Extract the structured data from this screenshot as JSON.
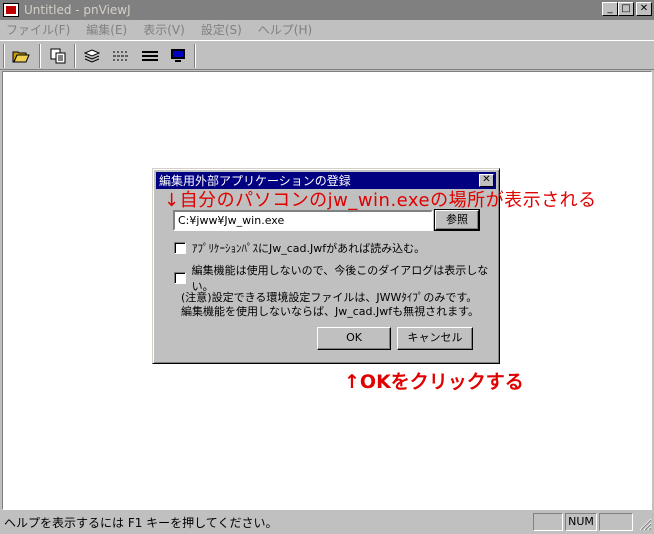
{
  "window": {
    "title": "Untitled - pnViewJ",
    "min_glyph": "_",
    "max_glyph": "□",
    "close_glyph": "✕"
  },
  "menu": [
    {
      "label": "ファイル(F)"
    },
    {
      "label": "編集(E)"
    },
    {
      "label": "表示(V)"
    },
    {
      "label": "設定(S)"
    },
    {
      "label": "ヘルプ(H)"
    }
  ],
  "toolbar": {
    "icons": [
      "folder-open-icon",
      "copy-icon",
      "layers-icon",
      "dashed-lines-icon",
      "solid-lines-icon",
      "monitor-icon"
    ]
  },
  "status": {
    "text": "ヘルプを表示するには F1 キーを押してください。",
    "num": "NUM"
  },
  "dialog": {
    "title": "編集用外部アプリケーションの登録",
    "close_glyph": "✕",
    "path_value": "C:¥jww¥Jw_win.exe",
    "browse_label": "参照",
    "check1_label": "ｱﾌﾟﾘｹｰｼｮﾝﾊﾟｽにJw_cad.Jwfがあれば読み込む。",
    "check1_checked": false,
    "check2_label": "編集機能は使用しないので、今後このダイアログは表示しない。",
    "check2_checked": false,
    "note_line1": "(注意)設定できる環境設定ファイルは、JWWﾀｲﾌﾟのみです。",
    "note_line2": "編集機能を使用しないならば、Jw_cad.Jwfも無視されます。",
    "ok_label": "OK",
    "cancel_label": "キャンセル"
  },
  "annotations": {
    "arrow_down": "↓",
    "text1": "自分のパソコンのjw_win.exeの場所が表示される",
    "arrow_up": "↑",
    "text2": "OKをクリックする",
    "color": "#e00000"
  }
}
